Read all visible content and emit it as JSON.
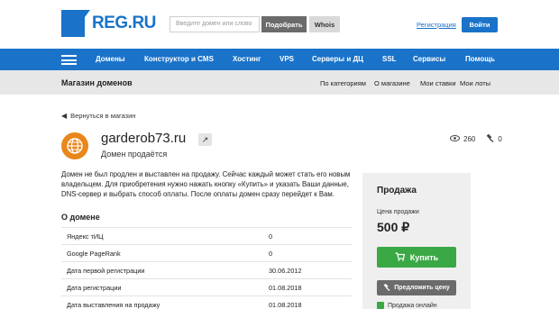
{
  "header": {
    "logo_text": "REG.RU",
    "search_placeholder": "Введите домен или слово",
    "pick_button": "Подобрать",
    "whois_button": "Whois",
    "register_link": "Регистрация",
    "login_button": "Войти"
  },
  "nav": {
    "items": [
      "Домены",
      "Конструктор и CMS",
      "Хостинг",
      "VPS",
      "Серверы и ДЦ",
      "SSL",
      "Сервисы",
      "Помощь"
    ]
  },
  "subbar": {
    "title": "Магазин доменов",
    "links": [
      "По категориям",
      "О магазине",
      "Мои ставки",
      "Мои лоты"
    ]
  },
  "back_link": "Вернуться в магазин",
  "domain": {
    "name": "garderob73.ru",
    "status": "Домен продаётся",
    "views": "260",
    "bids": "0"
  },
  "description": "Домен не был продлен и выставлен на продажу. Сейчас каждый может стать его новым владельцем. Для приобретения нужно нажать кнопку «Купить» и указать Ваши данные, DNS-сервер и выбрать способ оплаты. После оплаты домен сразу перейдет к Вам.",
  "about": {
    "title": "О домене",
    "rows": [
      {
        "label": "Яндекс тИЦ",
        "value": "0"
      },
      {
        "label": "Google PageRank",
        "value": "0"
      },
      {
        "label": "Дата первой регистрации",
        "value": "30.06.2012"
      },
      {
        "label": "Дата регистрации",
        "value": "01.08.2018"
      },
      {
        "label": "Дата выставления на продажу",
        "value": "01.08.2018"
      }
    ]
  },
  "sale": {
    "title": "Продажа",
    "price_label": "Цена продажи",
    "price": "500 ₽",
    "buy_button": "Купить",
    "offer_button": "Предложить цену",
    "online_label": "Продажа онлайн"
  },
  "colors": {
    "brand_blue": "#1a73c9",
    "buy_green": "#3aa845",
    "globe_orange": "#e8871a"
  }
}
